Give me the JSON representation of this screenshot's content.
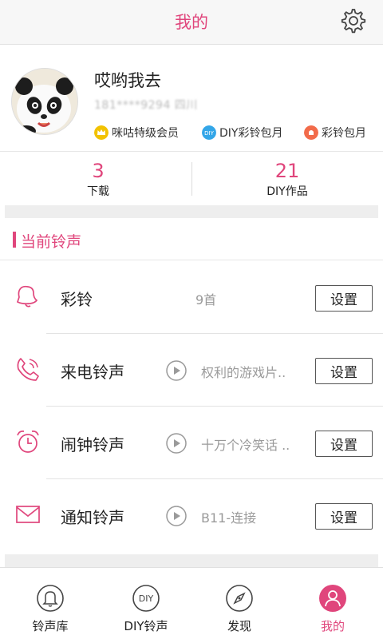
{
  "header": {
    "title": "我的",
    "settings_icon": "gear-icon"
  },
  "profile": {
    "nickname": "哎哟我去",
    "phone": "181****9294 四川",
    "avatar_icon": "panda-avatar",
    "badges": [
      {
        "label": "咪咕特级会员",
        "icon": "crown-icon",
        "color": "#f2c200"
      },
      {
        "label": "DIY彩铃包月",
        "icon": "diy-badge-icon",
        "color": "#33a6e8"
      },
      {
        "label": "彩铃包月",
        "icon": "ringtone-badge-icon",
        "color": "#f26b4a"
      }
    ]
  },
  "stats": [
    {
      "value": "3",
      "label": "下载"
    },
    {
      "value": "21",
      "label": "DIY作品"
    }
  ],
  "section": {
    "title": "当前铃声"
  },
  "rings": [
    {
      "name": "彩铃",
      "info": "9首",
      "icon": "bell-icon",
      "has_play": false,
      "button": "设置"
    },
    {
      "name": "来电铃声",
      "info": "权利的游戏片..",
      "icon": "phone-icon",
      "has_play": true,
      "button": "设置"
    },
    {
      "name": "闹钟铃声",
      "info": "十万个冷笑话 ..",
      "icon": "alarm-clock-icon",
      "has_play": true,
      "button": "设置"
    },
    {
      "name": "通知铃声",
      "info": "B11-连接",
      "icon": "envelope-icon",
      "has_play": true,
      "button": "设置"
    }
  ],
  "tabs": [
    {
      "label": "铃声库",
      "icon": "bell-icon",
      "active": false
    },
    {
      "label": "DIY铃声",
      "icon": "diy-icon",
      "active": false
    },
    {
      "label": "发现",
      "icon": "compass-icon",
      "active": false
    },
    {
      "label": "我的",
      "icon": "user-icon",
      "active": true
    }
  ],
  "colors": {
    "accent": "#e0467c",
    "text": "#222222",
    "muted": "#9a9a9a",
    "gap": "#eeeeee"
  }
}
